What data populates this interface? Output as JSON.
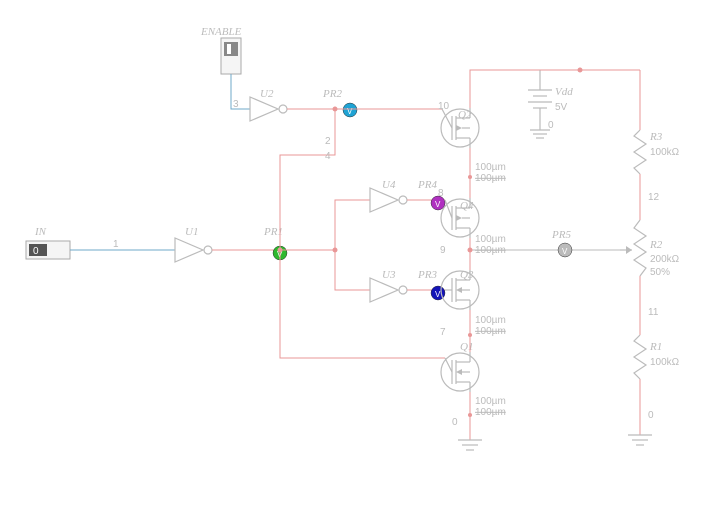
{
  "inputs": {
    "in": {
      "label": "IN",
      "value": "0"
    },
    "enable": {
      "label": "ENABLE",
      "value": ""
    }
  },
  "gates": {
    "u1": "U1",
    "u2": "U2",
    "u3": "U3",
    "u4": "U4"
  },
  "probes": {
    "pr1": {
      "label": "PR1",
      "color": "#2eb82e"
    },
    "pr2": {
      "label": "PR2",
      "color": "#1fa3d4"
    },
    "pr3": {
      "label": "PR3",
      "color": "#1414b8"
    },
    "pr4": {
      "label": "PR4",
      "color": "#b030c0"
    },
    "pr5": {
      "label": "PR5",
      "color": "#bbbbbb"
    }
  },
  "transistors": {
    "q1": {
      "label": "Q1",
      "w": "100µm",
      "l": "100µm"
    },
    "q2": {
      "label": "Q2",
      "w": "100µm",
      "l": "100µm"
    },
    "q3": {
      "label": "Q3",
      "w": "100µm",
      "l": "100µm"
    },
    "q4": {
      "label": "Q4",
      "w": "100µm",
      "l": "100µm"
    }
  },
  "resistors": {
    "r1": {
      "label": "R1",
      "value": "100kΩ"
    },
    "r2": {
      "label": "R2",
      "value": "200kΩ",
      "percent": "50%"
    },
    "r3": {
      "label": "R3",
      "value": "100kΩ"
    }
  },
  "vdd": {
    "label": "Vdd",
    "value": "5V"
  },
  "nodes": {
    "n0a": "0",
    "n0b": "0",
    "n0c": "0",
    "n1": "1",
    "n2": "2",
    "n3": "3",
    "n4": "4",
    "n7": "7",
    "n8": "8",
    "n9": "9",
    "n10": "10",
    "n11": "11",
    "n12": "12"
  }
}
